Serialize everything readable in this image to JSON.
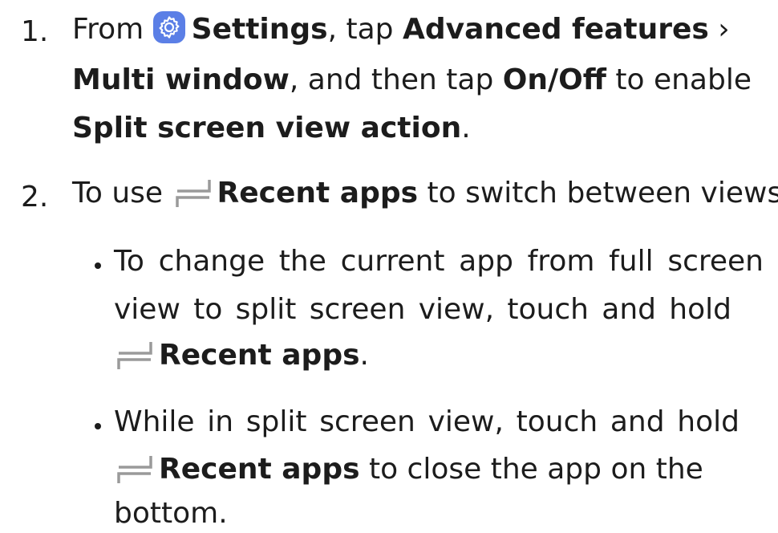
{
  "steps": [
    {
      "number": "1.",
      "line1": {
        "t1": "From",
        "icon": "settings-gear-icon",
        "b1": "Settings",
        "t2": ", tap",
        "b2": "Advanced features",
        "t3": " ›"
      },
      "line2": {
        "b1": "Multi window",
        "t1": ", and then tap",
        "b2": "On/Off",
        "t2": " to enable"
      },
      "line3": {
        "b1": "Split screen view action",
        "t1": "."
      }
    },
    {
      "number": "2.",
      "line1": {
        "t1": "To use",
        "icon": "recent-apps-icon",
        "b1": "Recent apps",
        "t2": " to switch between views:"
      },
      "bullets": [
        {
          "line1": "To change the current app from full screen",
          "line2": "view to split screen view, touch and hold",
          "line3": {
            "icon": "recent-apps-icon",
            "b1": "Recent apps",
            "t1": "."
          }
        },
        {
          "line1": "While in split screen view, touch and hold",
          "line2": {
            "icon": "recent-apps-icon",
            "b1": "Recent apps",
            "t1": " to close the app on the"
          },
          "line3": "bottom."
        }
      ]
    }
  ],
  "colors": {
    "text": "#1c1c1c",
    "settings_icon_bg": "#5b7fe6",
    "recent_icon": "#9a9a9a"
  }
}
